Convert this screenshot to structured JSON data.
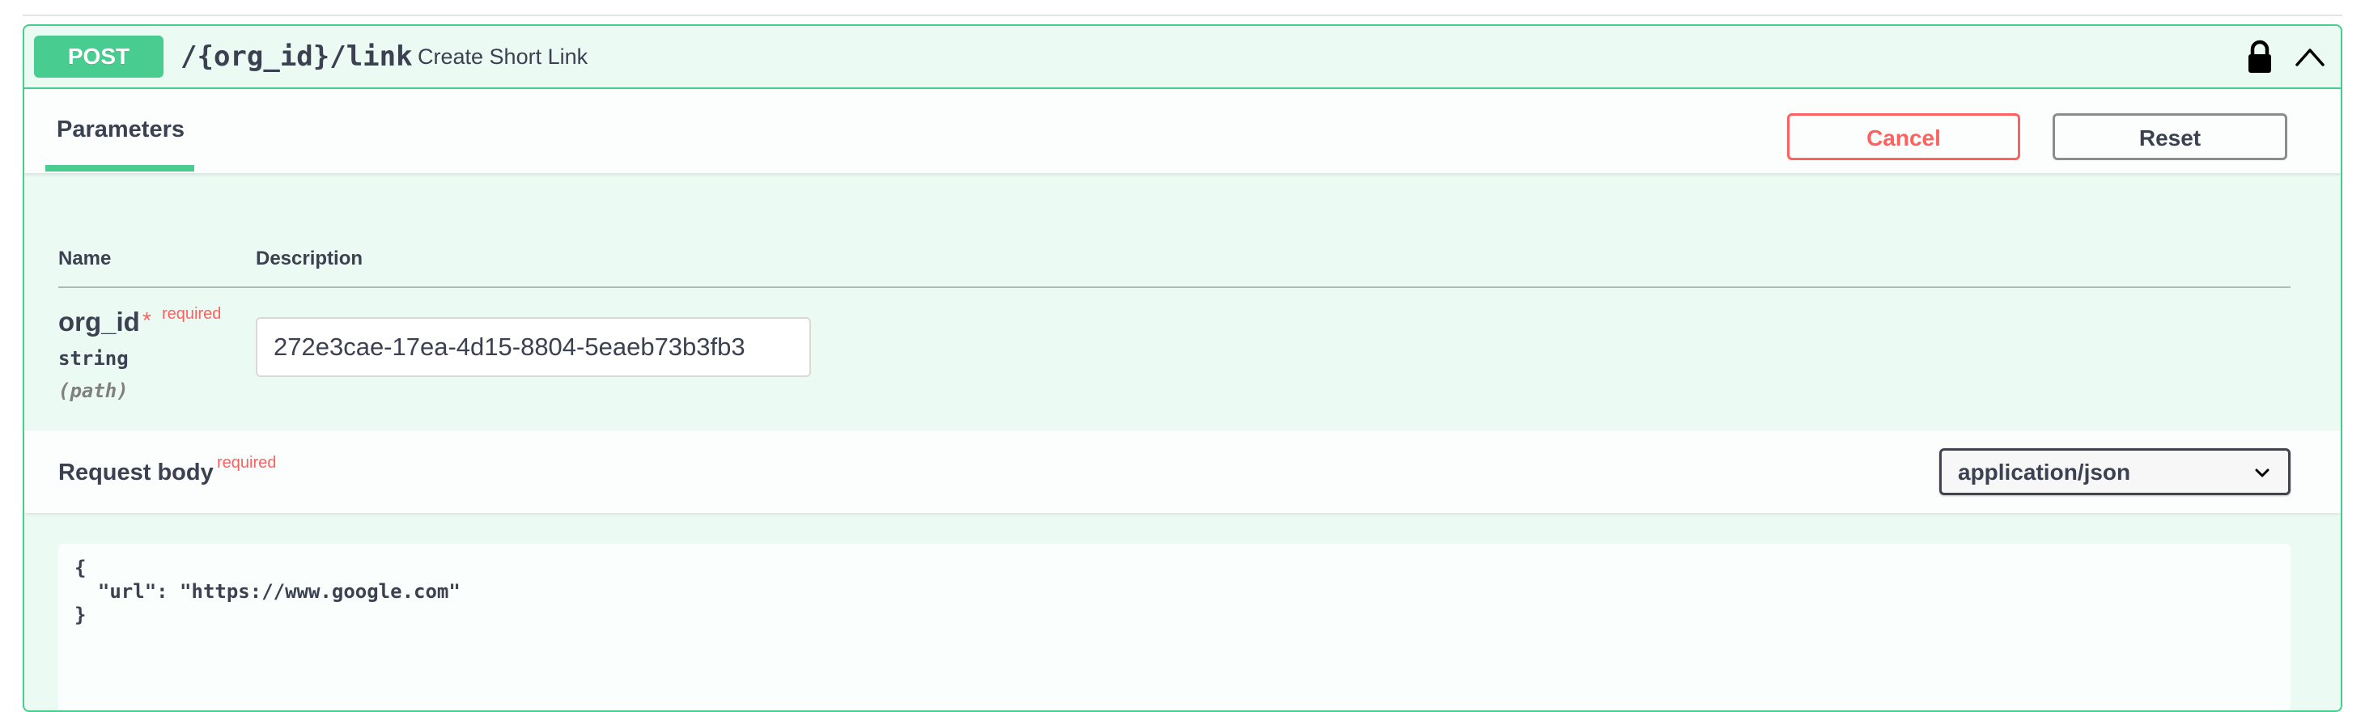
{
  "operation": {
    "method": "POST",
    "path": "/{org_id}/link",
    "summary": "Create Short Link"
  },
  "parameters_section": {
    "tab_label": "Parameters",
    "cancel_label": "Cancel",
    "reset_label": "Reset",
    "column_name": "Name",
    "column_description": "Description",
    "params": [
      {
        "name": "org_id",
        "asterisk": "*",
        "required_label": "required",
        "type": "string",
        "in": "(path)",
        "value": "272e3cae-17ea-4d15-8804-5eaeb73b3fb3"
      }
    ]
  },
  "request_body": {
    "title": "Request body",
    "required_label": "required",
    "content_type": "application/json",
    "code": "{\n  \"url\": \"https://www.google.com\"\n}"
  },
  "icons": {
    "lock": "lock-icon",
    "collapse": "chevron-up-icon",
    "select_arrow": "chevron-down-icon"
  },
  "colors": {
    "post_green": "#49cc90",
    "required_red": "#ff6060",
    "text": "#3b4151"
  }
}
